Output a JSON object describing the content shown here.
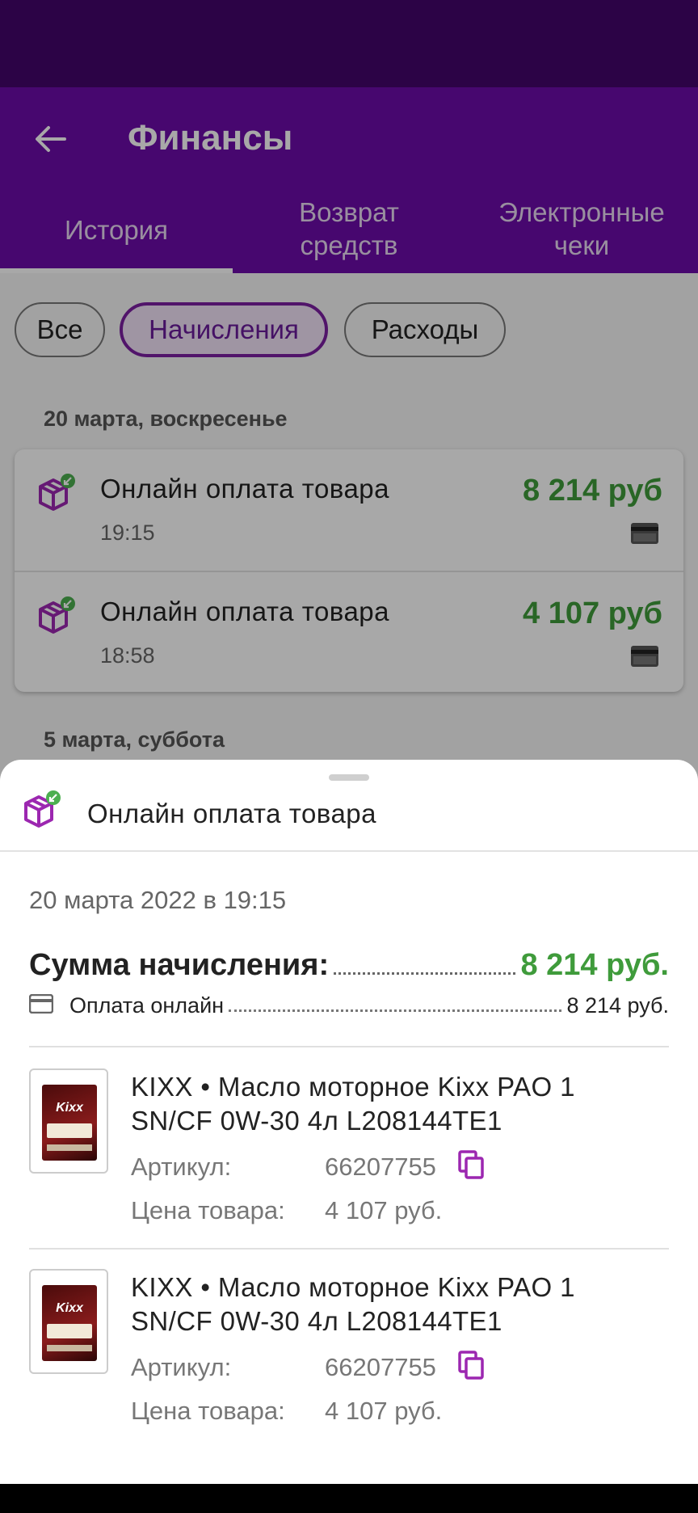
{
  "header": {
    "title": "Финансы"
  },
  "tabs": [
    {
      "label": "История"
    },
    {
      "label": "Возврат\nсредств"
    },
    {
      "label": "Электронные\nчеки"
    }
  ],
  "filters": {
    "all": "Все",
    "income": "Начисления",
    "expense": "Расходы"
  },
  "history": {
    "date_1": "20 марта, воскресенье",
    "date_2": "5 марта, суббота",
    "transactions": [
      {
        "title": "Онлайн оплата товара",
        "time": "19:15",
        "amount": "8 214 руб"
      },
      {
        "title": "Онлайн оплата товара",
        "time": "18:58",
        "amount": "4 107 руб"
      }
    ]
  },
  "sheet": {
    "title": "Онлайн оплата товара",
    "datetime": "20 марта 2022 в 19:15",
    "sum_label": "Сумма начисления:",
    "sum_value": "8 214 руб.",
    "payment_label": "Оплата онлайн",
    "payment_value": "8 214 руб.",
    "products": [
      {
        "name": "KIXX • Масло моторное Kixx PAO 1 SN/CF 0W-30 4л L208144TE1",
        "sku_label": "Артикул:",
        "sku": "66207755",
        "price_label": "Цена товара:",
        "price": "4 107 руб.",
        "can_brand": "Kixx"
      },
      {
        "name": "KIXX • Масло моторное Kixx PAO 1 SN/CF 0W-30 4л L208144TE1",
        "sku_label": "Артикул:",
        "sku": "66207755",
        "price_label": "Цена товара:",
        "price": "4 107 руб.",
        "can_brand": "Kixx"
      }
    ]
  },
  "colors": {
    "primary": "#6c0ba9",
    "status_bar": "#44066b",
    "accent": "#7b1fa2",
    "amount_green": "#3f9b3b"
  },
  "icons": {
    "back": "arrow-back-icon",
    "transaction": "package-incoming-icon",
    "card": "credit-card-icon",
    "copy": "copy-icon"
  }
}
